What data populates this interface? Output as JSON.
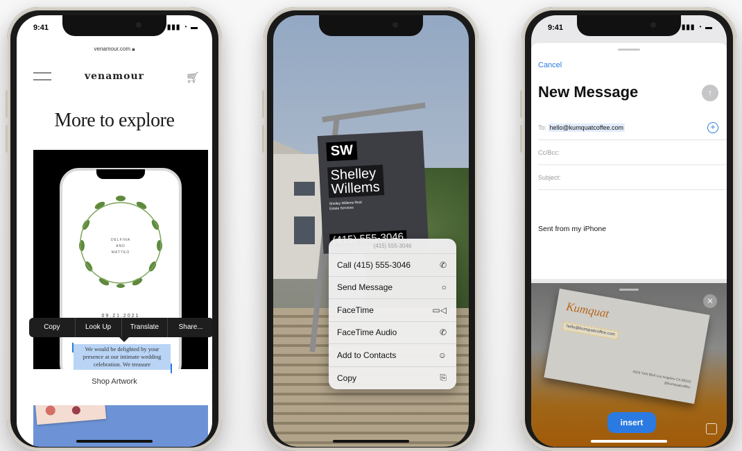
{
  "phone1": {
    "status_time": "9:41",
    "status_icons": "▮▮▮ ◔ ▬",
    "url": "venamour.com",
    "brand": "venamour",
    "heading": "More to explore",
    "wreath_text": [
      "DELFINA",
      "AND",
      "MATTEO"
    ],
    "date": "09.21.2021",
    "context_menu": [
      "Copy",
      "Look Up",
      "Translate",
      "Share..."
    ],
    "selected_text": "We would be delighted by your presence at our intimate wedding celebration. We treasure",
    "shop_label": "Shop Artwork"
  },
  "phone2": {
    "sign_initials": "SW",
    "sign_name": "Shelley Willems",
    "sign_sub": "Shelley Willems Real Estate Services",
    "sign_phone": "(415) 555-3046",
    "menu_header": "(415) 555-3046",
    "menu_items": [
      {
        "label": "Call (415) 555-3046",
        "icon": "phone-icon"
      },
      {
        "label": "Send Message",
        "icon": "message-icon"
      },
      {
        "label": "FaceTime",
        "icon": "video-icon"
      },
      {
        "label": "FaceTime Audio",
        "icon": "phone-icon"
      },
      {
        "label": "Add to Contacts",
        "icon": "contact-add-icon"
      },
      {
        "label": "Copy",
        "icon": "copy-icon"
      }
    ]
  },
  "phone3": {
    "status_time": "9:41",
    "status_icons": "▮▮▮ ◔ ▬",
    "cancel_label": "Cancel",
    "title": "New Message",
    "to_label": "To:",
    "to_value": "hello@kumquatcoffee.com",
    "cc_label": "Cc/Bcc:",
    "subject_label": "Subject:",
    "signature": "Sent from my iPhone",
    "card_brand": "Kumquat",
    "card_email": "hello@kumquatcoffee.com",
    "card_address": "4926 York Blvd Los Angeles CA 90042",
    "card_handle": "@kumquatcoffee",
    "insert_label": "insert"
  },
  "colors": {
    "accent": "#2a7ae2",
    "menu_bg": "#f0f0f0",
    "dark": "#1e1e1e"
  }
}
